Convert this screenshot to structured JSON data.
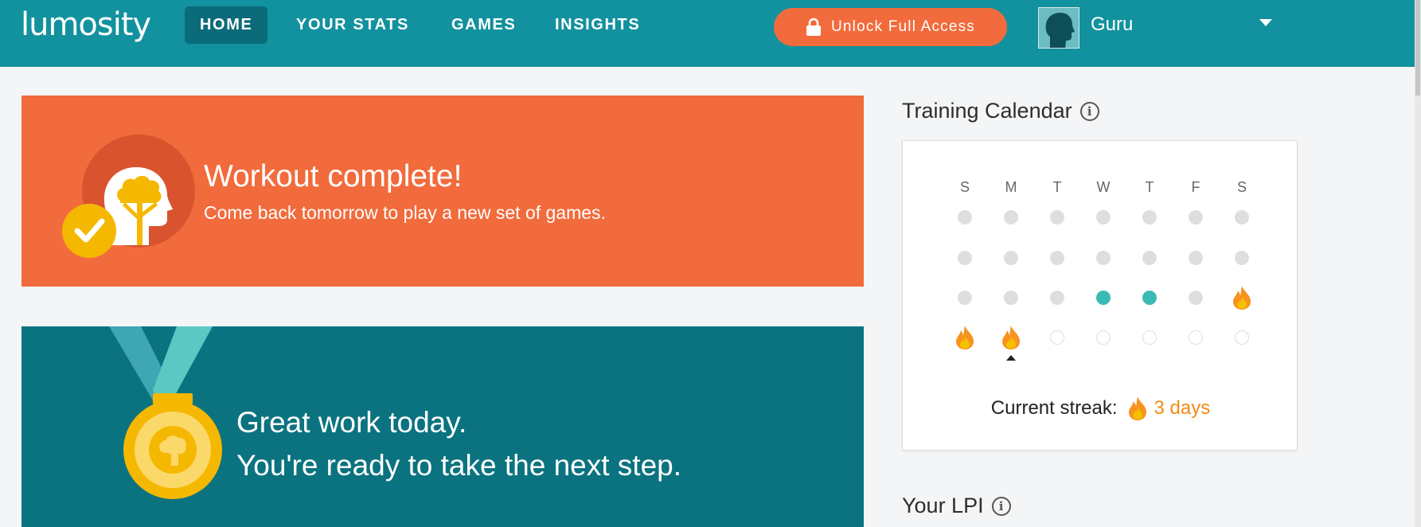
{
  "header": {
    "logo": "lumosity",
    "nav": [
      {
        "label": "HOME",
        "active": true
      },
      {
        "label": "YOUR STATS",
        "active": false
      },
      {
        "label": "GAMES",
        "active": false
      },
      {
        "label": "INSIGHTS",
        "active": false
      }
    ],
    "unlock_label": "Unlock Full Access",
    "user_name": "Guru"
  },
  "workout": {
    "title": "Workout complete!",
    "subtitle": "Come back tomorrow to play a new set of games."
  },
  "promo": {
    "line1": "Great work today.",
    "line2": "You're ready to take the next step."
  },
  "calendar": {
    "title": "Training Calendar",
    "days": [
      "S",
      "M",
      "T",
      "W",
      "T",
      "F",
      "S"
    ],
    "weeks": [
      [
        "none",
        "none",
        "none",
        "none",
        "none",
        "none",
        "none"
      ],
      [
        "none",
        "none",
        "none",
        "none",
        "none",
        "none",
        "none"
      ],
      [
        "none",
        "none",
        "none",
        "trained",
        "trained",
        "none",
        "streak"
      ],
      [
        "streak",
        "streak",
        "future",
        "future",
        "future",
        "future",
        "future"
      ]
    ],
    "today": {
      "week": 3,
      "day": 1
    },
    "streak_label": "Current streak:",
    "streak_value": "3 days"
  },
  "lpi": {
    "title": "Your LPI"
  },
  "colors": {
    "header_bg": "#12919e",
    "nav_active": "#0c6b79",
    "accent_orange": "#f26b3c",
    "promo_bg": "#0b7380",
    "trained_dot": "#3db9b5",
    "streak_orange": "#f38b15"
  },
  "icons": [
    "lock-icon",
    "avatar-icon",
    "chevron-down-icon",
    "brain-head-icon",
    "checkmark-icon",
    "medal-icon",
    "info-icon",
    "flame-icon"
  ]
}
